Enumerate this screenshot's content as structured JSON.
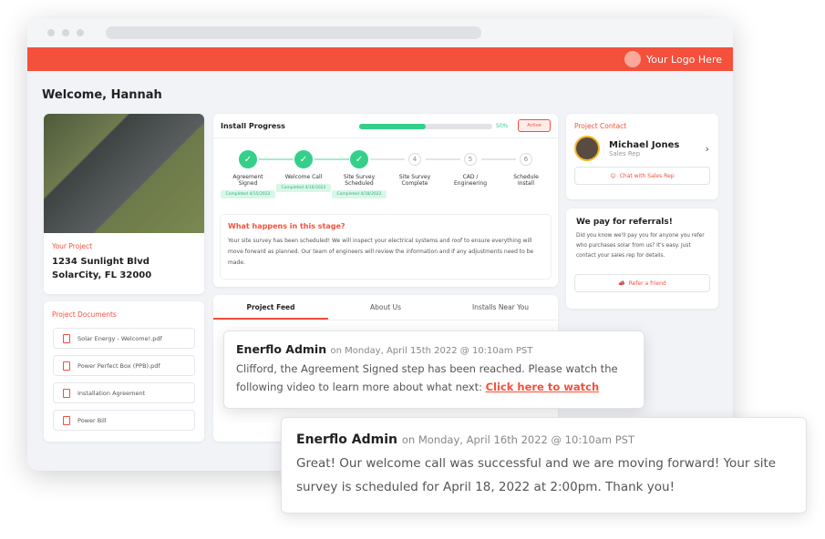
{
  "header": {
    "logo_text": "Your Logo Here",
    "brand_color": "#f4503c"
  },
  "welcome": "Welcome, Hannah",
  "project": {
    "label": "Your Project",
    "address1": "1234 Sunlight Blvd",
    "address2": "SolarCity, FL 32000"
  },
  "documents": {
    "title": "Project Documents",
    "items": [
      "Solar Energy - Welcome!.pdf",
      "Power Perfect Box (PPB).pdf",
      "Installation Agreement",
      "Power Bill"
    ]
  },
  "progress": {
    "title": "Install Progress",
    "percent": 50,
    "percent_label": "50%",
    "status": "Active",
    "steps": [
      {
        "num": "1",
        "label1": "Agreement",
        "label2": "Signed",
        "done": true,
        "badge": "Completed 4/15/2022"
      },
      {
        "num": "2",
        "label1": "Welcome Call",
        "label2": "",
        "done": true,
        "badge": "Completed 4/16/2022"
      },
      {
        "num": "3",
        "label1": "Site Survey",
        "label2": "Scheduled",
        "done": true,
        "badge": "Completed 4/18/2022"
      },
      {
        "num": "4",
        "label1": "Site Survey",
        "label2": "Complete",
        "done": false
      },
      {
        "num": "5",
        "label1": "CAD /",
        "label2": "Engineering",
        "done": false
      },
      {
        "num": "6",
        "label1": "Schedule",
        "label2": "Install",
        "done": false
      }
    ]
  },
  "stage": {
    "title": "What happens in this stage?",
    "text": "Your site survey has been scheduled! We will inspect your electrical systems and roof to ensure everything will move forward as planned. Our team of engineers will review the information and if any adjustments need to be made."
  },
  "tabs": [
    "Project Feed",
    "About Us",
    "Installs Near You"
  ],
  "contact": {
    "title": "Project Contact",
    "name": "Michael Jones",
    "role": "Sales Rep",
    "chat": "Chat with Sales Rep"
  },
  "referral": {
    "title": "We pay for referrals!",
    "text": "Did you know we'll pay you for anyone you refer who purchases solar from us? It's easy. Just contact your sales rep for details.",
    "button": "Refer a friend"
  },
  "feed": [
    {
      "author": "Enerflo Admin",
      "meta": "on Monday, April 15th 2022 @ 10:10am PST",
      "text": "Clifford, the Agreement Signed step has been reached. Please watch the following video to learn more about what next: ",
      "link": "Click here to watch"
    },
    {
      "author": "Enerflo Admin",
      "meta": "on Monday, April 16th 2022 @ 10:10am PST",
      "text": "Great! Our welcome call was successful and we are moving forward! Your site survey is scheduled for April 18, 2022 at 2:00pm. Thank you!"
    }
  ]
}
